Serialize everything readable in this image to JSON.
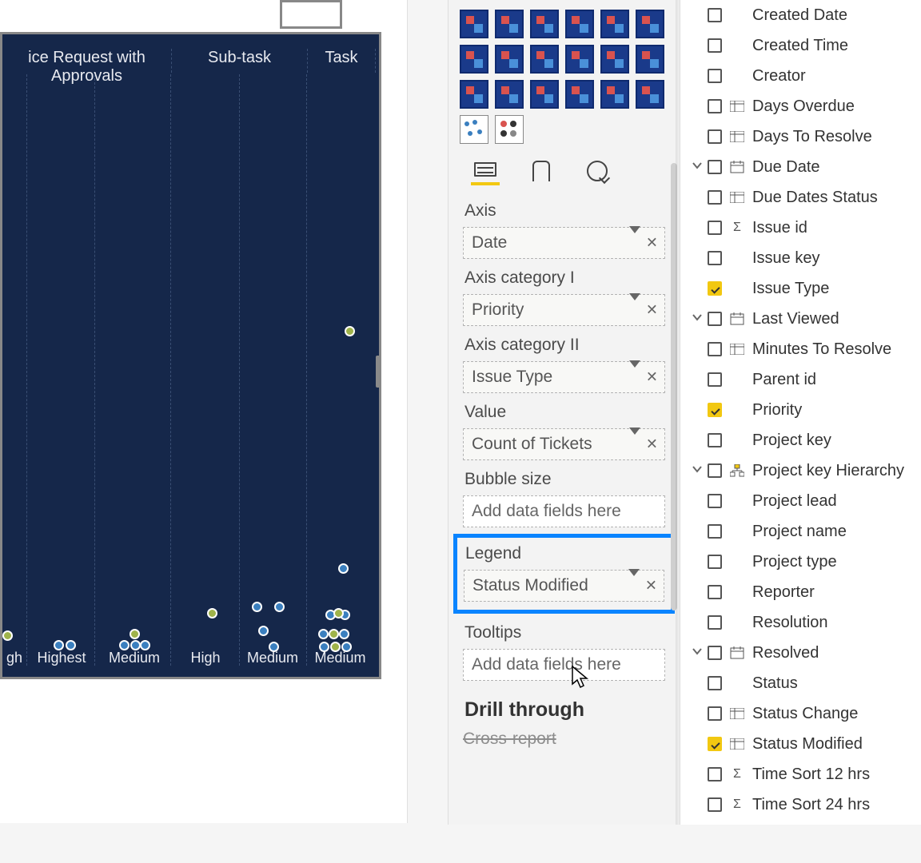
{
  "chart_data": {
    "type": "scatter",
    "title": "",
    "category1_label": "Issue Type",
    "category2_label": "Priority",
    "visible_columns": [
      {
        "issue_type": "Service Request with Approvals",
        "header_text": "ice Request with Approvals",
        "subcats": [
          "High",
          "Highest",
          "Medium"
        ]
      },
      {
        "issue_type": "Sub-task",
        "header_text": "Sub-task",
        "subcats": [
          "High",
          "Medium"
        ]
      },
      {
        "issue_type": "Task",
        "header_text": "Task",
        "subcats": [
          "Medium"
        ]
      }
    ],
    "legend_field": "Status Modified",
    "value_field": "Count of Tickets"
  },
  "chart_headers": {
    "c0": "ice Request with Approvals",
    "c1": "Sub-task",
    "c2": "Task"
  },
  "sublabels": {
    "s0": "gh",
    "s1": "Highest",
    "s2": "Medium",
    "s3": "High",
    "s4": "Medium",
    "s5": "Medium"
  },
  "wells": {
    "axis_label": "Axis",
    "axis_value": "Date",
    "cat1_label": "Axis category I",
    "cat1_value": "Priority",
    "cat2_label": "Axis category II",
    "cat2_value": "Issue Type",
    "value_label": "Value",
    "value_value": "Count of Tickets",
    "bubble_label": "Bubble size",
    "bubble_placeholder": "Add data fields here",
    "legend_label": "Legend",
    "legend_value": "Status Modified",
    "tooltips_label": "Tooltips",
    "tooltips_placeholder": "Add data fields here",
    "drill_label": "Drill through",
    "cross_label": "Cross-report"
  },
  "fields": [
    {
      "label": "Created Date",
      "checked": false,
      "icon": "",
      "exp": ""
    },
    {
      "label": "Created Time",
      "checked": false,
      "icon": "",
      "exp": ""
    },
    {
      "label": "Creator",
      "checked": false,
      "icon": "",
      "exp": ""
    },
    {
      "label": "Days Overdue",
      "checked": false,
      "icon": "t",
      "exp": ""
    },
    {
      "label": "Days To Resolve",
      "checked": false,
      "icon": "t",
      "exp": ""
    },
    {
      "label": "Due Date",
      "checked": false,
      "icon": "cal",
      "exp": "v"
    },
    {
      "label": "Due Dates Status",
      "checked": false,
      "icon": "t",
      "exp": ""
    },
    {
      "label": "Issue id",
      "checked": false,
      "icon": "sum",
      "exp": ""
    },
    {
      "label": "Issue key",
      "checked": false,
      "icon": "",
      "exp": ""
    },
    {
      "label": "Issue Type",
      "checked": true,
      "icon": "",
      "exp": ""
    },
    {
      "label": "Last Viewed",
      "checked": false,
      "icon": "cal",
      "exp": "v"
    },
    {
      "label": "Minutes To Resolve",
      "checked": false,
      "icon": "t",
      "exp": ""
    },
    {
      "label": "Parent id",
      "checked": false,
      "icon": "",
      "exp": ""
    },
    {
      "label": "Priority",
      "checked": true,
      "icon": "",
      "exp": ""
    },
    {
      "label": "Project key",
      "checked": false,
      "icon": "",
      "exp": ""
    },
    {
      "label": "Project key Hierarchy",
      "checked": false,
      "icon": "hier",
      "exp": "v"
    },
    {
      "label": "Project lead",
      "checked": false,
      "icon": "",
      "exp": ""
    },
    {
      "label": "Project name",
      "checked": false,
      "icon": "",
      "exp": ""
    },
    {
      "label": "Project type",
      "checked": false,
      "icon": "",
      "exp": ""
    },
    {
      "label": "Reporter",
      "checked": false,
      "icon": "",
      "exp": ""
    },
    {
      "label": "Resolution",
      "checked": false,
      "icon": "",
      "exp": ""
    },
    {
      "label": "Resolved",
      "checked": false,
      "icon": "cal",
      "exp": "v"
    },
    {
      "label": "Status",
      "checked": false,
      "icon": "",
      "exp": ""
    },
    {
      "label": "Status Change",
      "checked": false,
      "icon": "t",
      "exp": ""
    },
    {
      "label": "Status Modified",
      "checked": true,
      "icon": "t",
      "exp": ""
    },
    {
      "label": "Time Sort 12 hrs",
      "checked": false,
      "icon": "sum",
      "exp": ""
    },
    {
      "label": "Time Sort 24 hrs",
      "checked": false,
      "icon": "sum",
      "exp": ""
    }
  ]
}
